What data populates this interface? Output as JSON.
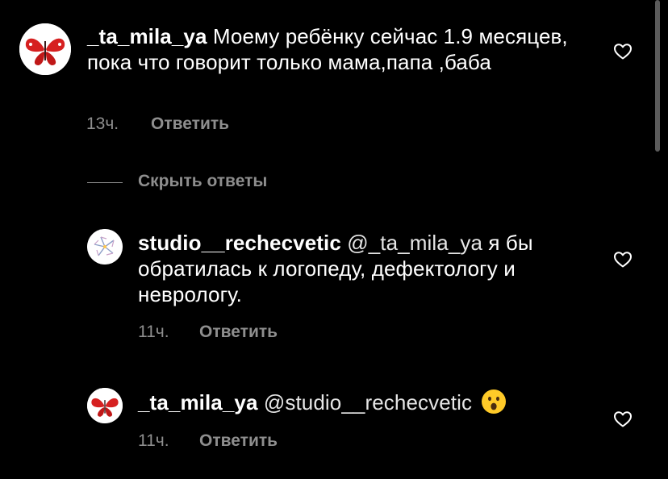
{
  "comments": [
    {
      "username": "_ta_mila_ya",
      "text": " Моему ребёнку сейчас 1.9 месяцев, пока что говорит только мама,папа ,баба",
      "time": "13ч.",
      "reply_label": "Ответить"
    },
    {
      "username": "studio__rechecvetic",
      "mention": " @_ta_mila_ya",
      "text": " я бы обратилась к логопеду, дефектологу и неврологу.",
      "time": "11ч.",
      "reply_label": "Ответить"
    },
    {
      "username": "_ta_mila_ya",
      "mention": " @studio__rechecvetic",
      "emoji": "😮",
      "time": "11ч.",
      "reply_label": "Ответить"
    }
  ],
  "hide_replies_label": "Скрыть ответы",
  "icons": {
    "like": "heart-outline-icon",
    "butterfly": "butterfly-avatar",
    "studio": "flower-logo-avatar"
  },
  "colors": {
    "background": "#000000",
    "text": "#ffffff",
    "secondary": "#8e8e8e"
  }
}
